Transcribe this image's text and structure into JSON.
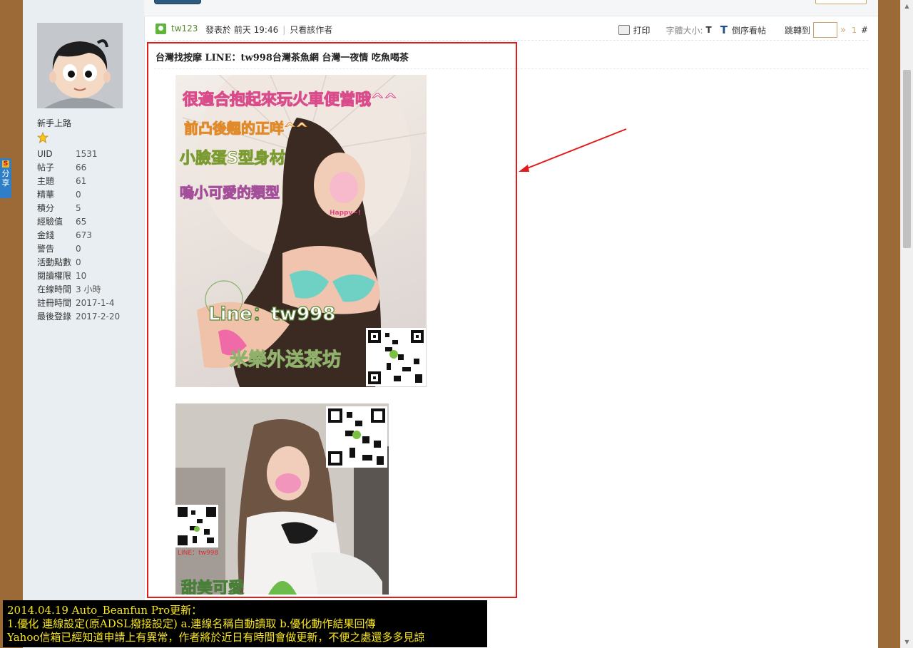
{
  "sidebar": {
    "rank_title": "新手上路",
    "stats": [
      {
        "label": "UID",
        "value": "1531"
      },
      {
        "label": "帖子",
        "value": "66"
      },
      {
        "label": "主題",
        "value": "61"
      },
      {
        "label": "精華",
        "value": "0"
      },
      {
        "label": "積分",
        "value": "5"
      },
      {
        "label": "經驗值",
        "value": "65"
      },
      {
        "label": "金錢",
        "value": "673"
      },
      {
        "label": "警告",
        "value": "0"
      },
      {
        "label": "活動點數",
        "value": "0"
      },
      {
        "label": "閱讀權限",
        "value": "10"
      },
      {
        "label": "在線時間",
        "value": "3 小時"
      },
      {
        "label": "註冊時間",
        "value": "2017-1-4"
      },
      {
        "label": "最後登錄",
        "value": "2017-2-20"
      }
    ]
  },
  "share_tab": {
    "badge": "S",
    "label": "分享"
  },
  "post": {
    "author": "tw123",
    "posted": "發表於 前天 19:46",
    "only_author": "只看該作者",
    "title": "台灣找按摩 LINE：tw998台灣茶魚網 台灣一夜情 吃魚喝茶"
  },
  "toolbar": {
    "print": "打印",
    "font_size_label": "字體大小:",
    "font_small": "T",
    "font_large": "T",
    "reverse": "倒序看帖",
    "jump": "跳轉到",
    "jump_arrow": "»",
    "floor": "1",
    "hash": "#"
  },
  "image1": {
    "lines": [
      "很適合抱起來玩火車便當哦^^",
      "前凸後翹的正咩^^",
      "小臉蛋S型身材",
      "嗚小可愛的類型"
    ],
    "bubble": "Happy~!",
    "line_id": "Line：tw998",
    "brand": "米樂外送茶坊"
  },
  "image2": {
    "line_id": "LINE：tw998",
    "caption": "甜美可愛"
  },
  "notice": {
    "line1": "2014.04.19 Auto_Beanfun Pro更新：",
    "line2": "1.優化 連線設定(原ADSL撥接設定) a.連線名稱自動讀取 b.優化動作結果回傳",
    "line3": "Yahoo信箱已經知道申請上有異常，作者將於近日有時間會做更新，不便之處還多多見諒"
  },
  "colors": {
    "annotation": "#e21b1b",
    "notice_text": "#f6e51c",
    "background": "#9c6a37"
  }
}
